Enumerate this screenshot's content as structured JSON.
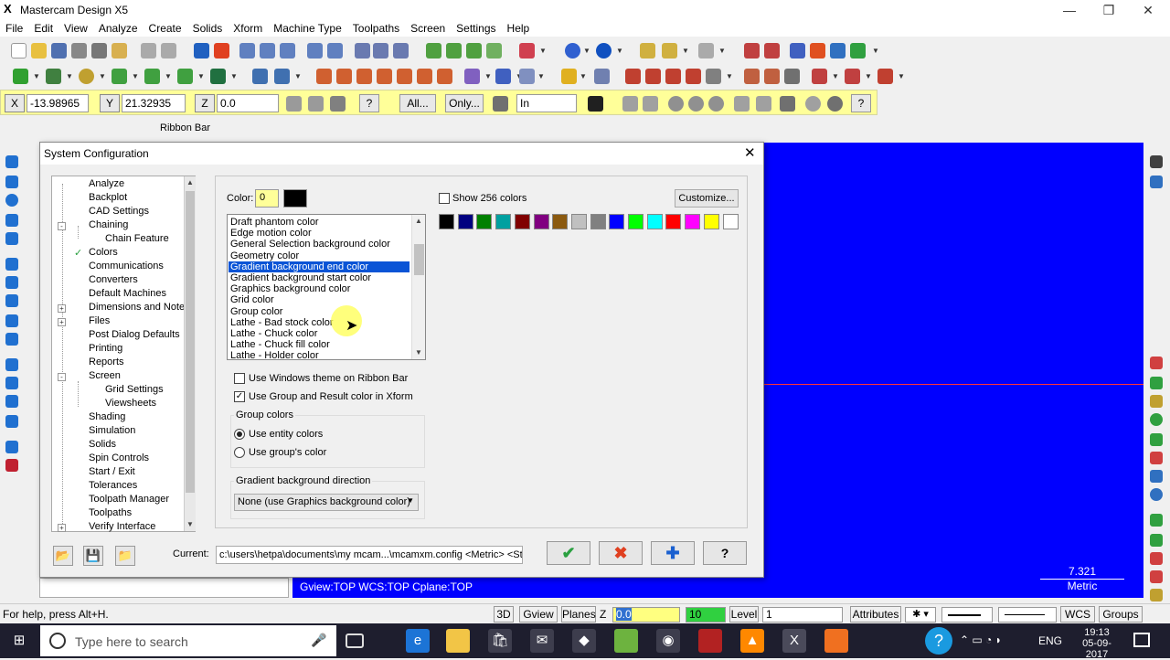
{
  "window": {
    "title": "Mastercam Design X5",
    "min_glyph": "—",
    "max_glyph": "❐",
    "close_glyph": "✕"
  },
  "menu": [
    "File",
    "Edit",
    "View",
    "Analyze",
    "Create",
    "Solids",
    "Xform",
    "Machine Type",
    "Toolpaths",
    "Screen",
    "Settings",
    "Help"
  ],
  "ribbon": {
    "x_label": "X",
    "x_value": "-13.98965",
    "y_label": "Y",
    "y_value": "21.32935",
    "z_label": "Z",
    "z_value": "0.0",
    "all_button": "All...",
    "only_button": "Only...",
    "units_value": "In",
    "help_glyph": "?"
  },
  "ribbon_bar_label": "Ribbon Bar",
  "dialog": {
    "title": "System Configuration",
    "close_glyph": "✕",
    "tree": [
      {
        "label": "Analyze",
        "indent": 0,
        "expander": ""
      },
      {
        "label": "Backplot",
        "indent": 0,
        "expander": ""
      },
      {
        "label": "CAD Settings",
        "indent": 0,
        "expander": ""
      },
      {
        "label": "Chaining",
        "indent": 0,
        "expander": "-"
      },
      {
        "label": "Chain Feature",
        "indent": 1,
        "expander": ""
      },
      {
        "label": "Colors",
        "indent": 0,
        "expander": "",
        "checked": true
      },
      {
        "label": "Communications",
        "indent": 0,
        "expander": ""
      },
      {
        "label": "Converters",
        "indent": 0,
        "expander": ""
      },
      {
        "label": "Default Machines",
        "indent": 0,
        "expander": ""
      },
      {
        "label": "Dimensions and Notes",
        "indent": 0,
        "expander": "+"
      },
      {
        "label": "Files",
        "indent": 0,
        "expander": "+"
      },
      {
        "label": "Post Dialog Defaults",
        "indent": 0,
        "expander": ""
      },
      {
        "label": "Printing",
        "indent": 0,
        "expander": ""
      },
      {
        "label": "Reports",
        "indent": 0,
        "expander": ""
      },
      {
        "label": "Screen",
        "indent": 0,
        "expander": "-"
      },
      {
        "label": "Grid Settings",
        "indent": 1,
        "expander": ""
      },
      {
        "label": "Viewsheets",
        "indent": 1,
        "expander": ""
      },
      {
        "label": "Shading",
        "indent": 0,
        "expander": ""
      },
      {
        "label": "Simulation",
        "indent": 0,
        "expander": ""
      },
      {
        "label": "Solids",
        "indent": 0,
        "expander": ""
      },
      {
        "label": "Spin Controls",
        "indent": 0,
        "expander": ""
      },
      {
        "label": "Start / Exit",
        "indent": 0,
        "expander": ""
      },
      {
        "label": "Tolerances",
        "indent": 0,
        "expander": ""
      },
      {
        "label": "Toolpath Manager",
        "indent": 0,
        "expander": ""
      },
      {
        "label": "Toolpaths",
        "indent": 0,
        "expander": ""
      },
      {
        "label": "Verify Interface",
        "indent": 0,
        "expander": "+"
      }
    ],
    "check_glyph": "✓",
    "color_label": "Color:",
    "color_value": "0",
    "color_list": [
      "Draft phantom color",
      "Edge motion color",
      "General Selection background color",
      "Geometry color",
      "Gradient background end color",
      "Gradient background start color",
      "Graphics background color",
      "Grid color",
      "Group color",
      "Lathe - Bad stock color",
      "Lathe - Chuck color",
      "Lathe - Chuck fill color",
      "Lathe - Holder color"
    ],
    "selected_index": 4,
    "show256_label": "Show 256 colors",
    "customize_button": "Customize...",
    "palette": [
      "#000000",
      "#000080",
      "#008000",
      "#00a0a0",
      "#800000",
      "#800080",
      "#8b5a10",
      "#c0c0c0",
      "#808080",
      "#0000ff",
      "#00ff00",
      "#00ffff",
      "#ff0000",
      "#ff00ff",
      "#ffff00",
      "#ffffff"
    ],
    "use_windows_theme_label": "Use Windows theme on Ribbon Bar",
    "use_windows_theme_checked": false,
    "use_group_result_label": "Use Group and Result color in Xform",
    "use_group_result_checked": true,
    "group_colors_title": "Group colors",
    "use_entity_colors_label": "Use entity colors",
    "use_groups_color_label": "Use group's color",
    "gradient_title": "Gradient background direction",
    "gradient_value": "None (use Graphics background color)",
    "current_label": "Current:",
    "current_value": "c:\\users\\hetpa\\documents\\my mcam...\\mcamxm.config <Metric> <Star",
    "ok_glyph": "✔",
    "cancel_glyph": "✖",
    "apply_glyph": "✚",
    "help_glyph": "?"
  },
  "graphics": {
    "bottom_text": "Gview:TOP   WCS:TOP   Cplane:TOP",
    "scale_value": "7.321",
    "scale_unit": "Metric",
    "background": "#0000ff"
  },
  "statusbar": {
    "help_text": "For help, press Alt+H.",
    "mode_3d": "3D",
    "gview": "Gview",
    "planes": "Planes",
    "z_label": "Z",
    "z_value": "0.0",
    "color_value": "10",
    "level_label": "Level",
    "level_value": "1",
    "attributes": "Attributes",
    "wcs": "WCS",
    "groups": "Groups"
  },
  "taskbar": {
    "search_placeholder": "Type here to search",
    "language": "ENG",
    "time": "19:13",
    "date": "05-09-2017",
    "mic_glyph": "🎤",
    "help_glyph": "?"
  }
}
